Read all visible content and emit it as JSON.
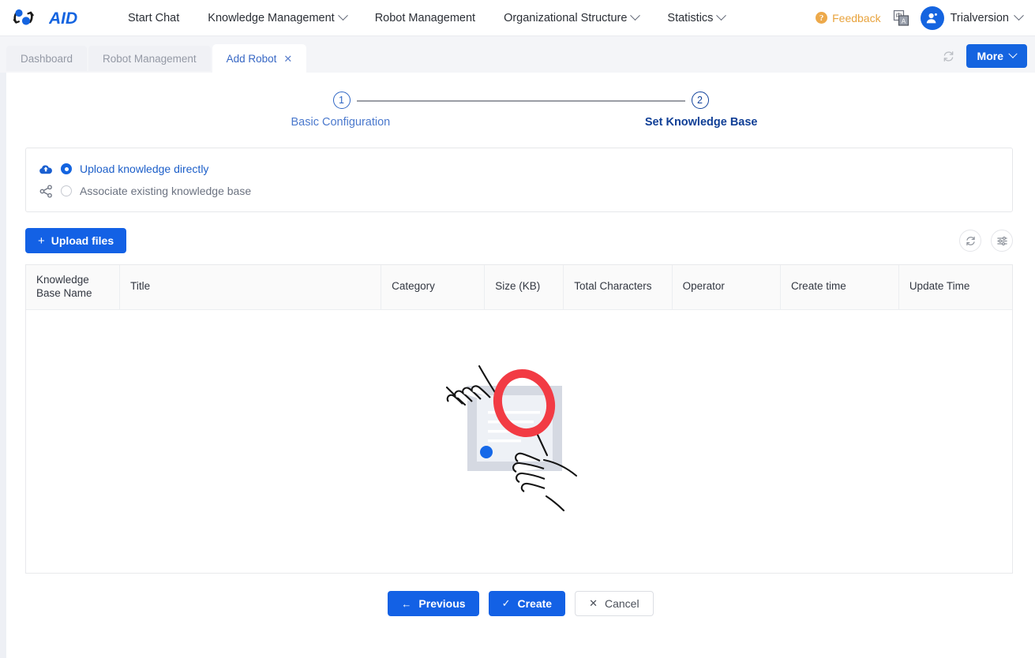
{
  "brand": {
    "name": "AID"
  },
  "nav": {
    "items": [
      {
        "label": "Start Chat",
        "has_caret": false
      },
      {
        "label": "Knowledge Management",
        "has_caret": true
      },
      {
        "label": "Robot Management",
        "has_caret": false
      },
      {
        "label": "Organizational Structure",
        "has_caret": true
      },
      {
        "label": "Statistics",
        "has_caret": true
      }
    ],
    "feedback_label": "Feedback",
    "language_icon": "language-switch-icon",
    "user_label": "Trialversion"
  },
  "tabs": {
    "items": [
      {
        "label": "Dashboard",
        "active": false,
        "closable": false
      },
      {
        "label": "Robot Management",
        "active": false,
        "closable": false
      },
      {
        "label": "Add Robot",
        "active": true,
        "closable": true
      }
    ],
    "close_glyph": "✕",
    "refresh_icon": "refresh-icon",
    "more_label": "More"
  },
  "stepper": {
    "steps": [
      {
        "number": "1",
        "label": "Basic Configuration",
        "active": false
      },
      {
        "number": "2",
        "label": "Set Knowledge Base",
        "active": true
      }
    ]
  },
  "source": {
    "options": [
      {
        "label": "Upload knowledge directly",
        "icon": "cloud-upload-icon",
        "selected": true
      },
      {
        "label": "Associate existing knowledge base",
        "icon": "share-nodes-icon",
        "selected": false
      }
    ]
  },
  "toolbar": {
    "upload_label": "Upload files",
    "upload_plus": "+",
    "refresh_icon": "refresh-icon",
    "settings_icon": "column-settings-icon"
  },
  "table": {
    "columns": [
      "Knowledge Base Name",
      "Title",
      "Category",
      "Size (KB)",
      "Total Characters",
      "Operator",
      "Create time",
      "Update Time"
    ],
    "rows": [],
    "empty_illustration": "document-magnifier-hands-illustration"
  },
  "footer": {
    "previous_label": "Previous",
    "previous_glyph": "←",
    "create_label": "Create",
    "create_glyph": "✓",
    "cancel_label": "Cancel",
    "cancel_glyph": "✕"
  },
  "colors": {
    "primary": "#1361e5",
    "accent_orange": "#e8a33d",
    "step_active": "#103f96",
    "page_bg": "#eef0f5"
  }
}
